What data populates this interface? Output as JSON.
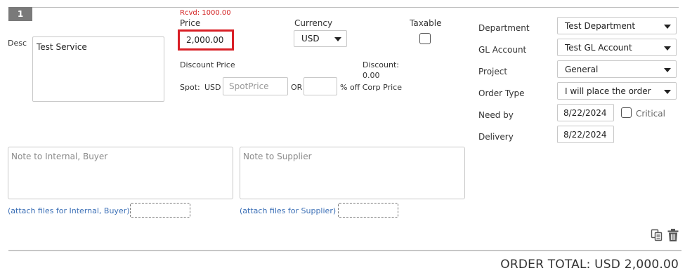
{
  "line": {
    "number": "1"
  },
  "desc": {
    "label": "Desc",
    "value": "Test Service"
  },
  "price": {
    "received": "Rcvd: 1000.00",
    "label": "Price",
    "value": "2,000.00"
  },
  "currency": {
    "label": "Currency",
    "value": "USD"
  },
  "taxable": {
    "label": "Taxable",
    "checked": false
  },
  "discount": {
    "price_label": "Discount Price",
    "label": "Discount:",
    "value": "0.00",
    "spot_label": "Spot:",
    "spot_currency": "USD",
    "spot_placeholder": "SpotPrice",
    "or_label": "OR",
    "percent_value": "",
    "percent_label": "% off Corp Price"
  },
  "right": {
    "department": {
      "label": "Department",
      "value": "Test Department"
    },
    "gl_account": {
      "label": "GL Account",
      "value": "Test GL Account"
    },
    "project": {
      "label": "Project",
      "value": "General"
    },
    "order_type": {
      "label": "Order Type",
      "value": "I will place the order"
    },
    "need_by": {
      "label": "Need by",
      "value": "8/22/2024",
      "critical_label": "Critical",
      "critical_checked": false
    },
    "delivery": {
      "label": "Delivery",
      "value": "8/22/2024"
    }
  },
  "notes": {
    "internal_placeholder": "Note to Internal, Buyer",
    "internal_attach": "(attach files for Internal, Buyer)",
    "supplier_placeholder": "Note to Supplier",
    "supplier_attach": "(attach files for Supplier)"
  },
  "icons": {
    "copy": "copy-icon",
    "delete": "trash-icon"
  },
  "colors": {
    "highlight": "#d91f26",
    "received": "#d21f1f",
    "link": "#3b6fb6",
    "badge": "#7a7a7a"
  },
  "order_total": "ORDER TOTAL: USD 2,000.00"
}
